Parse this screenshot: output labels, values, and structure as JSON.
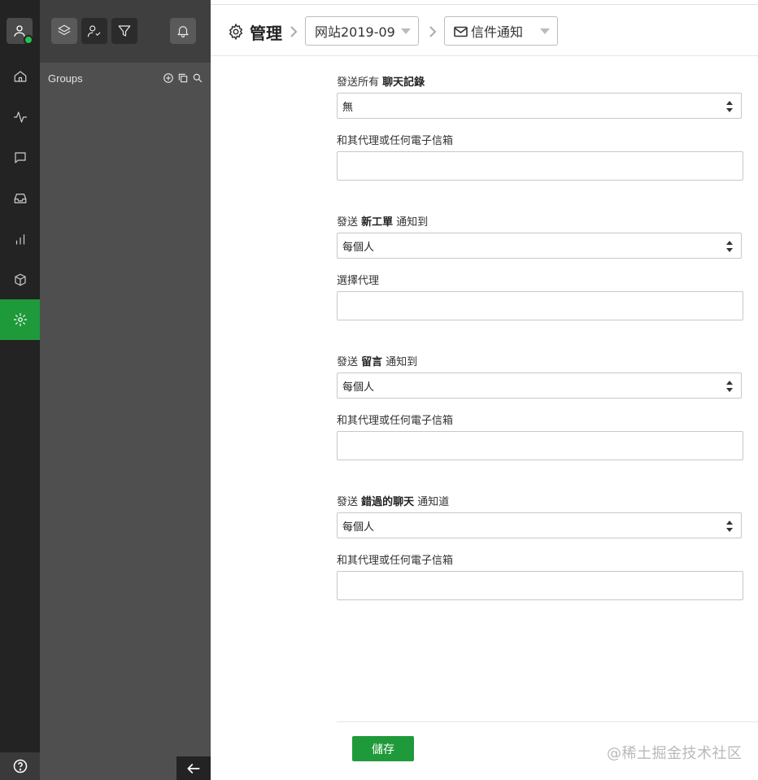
{
  "sidebar": {
    "items": [
      {
        "name": "home-icon",
        "active": false
      },
      {
        "name": "activity-icon",
        "active": false
      },
      {
        "name": "chat-icon",
        "active": false
      },
      {
        "name": "inbox-icon",
        "active": false
      },
      {
        "name": "reports-icon",
        "active": false
      },
      {
        "name": "package-icon",
        "active": false
      },
      {
        "name": "settings-icon",
        "active": true
      }
    ],
    "help_icon": "help-icon",
    "presence_color": "#27c24c"
  },
  "panel": {
    "groups_label": "Groups",
    "tools": [
      "layers-icon",
      "user-check-icon",
      "filter-icon",
      "bell-icon"
    ],
    "group_tools": [
      "add-circle-icon",
      "copy-icon",
      "search-icon"
    ],
    "back_icon": "arrow-left-icon"
  },
  "header": {
    "title": "管理",
    "site_select": "网站2019-09",
    "section_select": "信件通知"
  },
  "form": {
    "fields": [
      {
        "label_prefix": "發送所有 ",
        "label_bold": "聊天記錄",
        "label_suffix": "",
        "select_value": "無",
        "input_label": "和其代理或任何電子信箱",
        "input_value": ""
      },
      {
        "label_prefix": "發送 ",
        "label_bold": "新工單",
        "label_suffix": " 通知到",
        "select_value": "每個人",
        "input_label": "選擇代理",
        "input_value": ""
      },
      {
        "label_prefix": "發送 ",
        "label_bold": "留言",
        "label_suffix": " 通知到",
        "select_value": "每個人",
        "input_label": "和其代理或任何電子信箱",
        "input_value": ""
      },
      {
        "label_prefix": "發送 ",
        "label_bold": "錯過的聊天",
        "label_suffix": " 通知道",
        "select_value": "每個人",
        "input_label": "和其代理或任何電子信箱",
        "input_value": ""
      }
    ],
    "save_label": "儲存"
  },
  "watermark": "@稀土掘金技术社区",
  "colors": {
    "accent": "#1f9a3b",
    "rail_bg": "#232323",
    "panel_bg": "#4f4f4f"
  }
}
